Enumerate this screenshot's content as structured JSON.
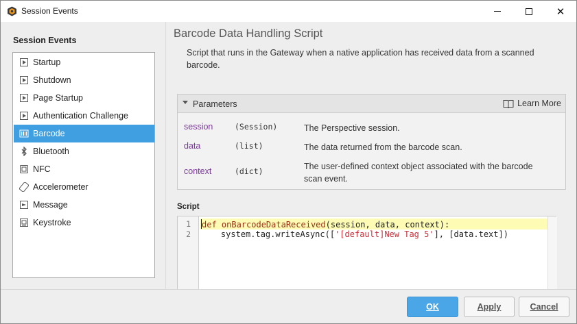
{
  "window": {
    "title": "Session Events",
    "controls": {
      "minimize": "minimize-icon",
      "maximize": "maximize-icon",
      "close": "✕"
    }
  },
  "left": {
    "header": "Session Events",
    "items": [
      {
        "label": "Startup",
        "icon": "play-page-icon"
      },
      {
        "label": "Shutdown",
        "icon": "play-page-icon"
      },
      {
        "label": "Page Startup",
        "icon": "play-page-icon"
      },
      {
        "label": "Authentication Challenge",
        "icon": "play-page-icon"
      },
      {
        "label": "Barcode",
        "icon": "barcode-icon",
        "selected": true
      },
      {
        "label": "Bluetooth",
        "icon": "bluetooth-icon"
      },
      {
        "label": "NFC",
        "icon": "nfc-icon"
      },
      {
        "label": "Accelerometer",
        "icon": "accelerometer-icon"
      },
      {
        "label": "Message",
        "icon": "message-icon"
      },
      {
        "label": "Keystroke",
        "icon": "keystroke-icon"
      }
    ]
  },
  "main": {
    "title": "Barcode Data Handling Script",
    "description": "Script that runs in the Gateway when a native application has received data from a scanned barcode.",
    "parameters": {
      "label": "Parameters",
      "learn_more": "Learn More",
      "rows": [
        {
          "name": "session",
          "type": "(Session)",
          "desc": "The Perspective session."
        },
        {
          "name": "data",
          "type": "(list)",
          "desc": "The data returned from the barcode scan."
        },
        {
          "name": "context",
          "type": "(dict)",
          "desc": "The user-defined context object associated with the barcode scan event."
        }
      ]
    },
    "script": {
      "label": "Script",
      "line_numbers": [
        "1",
        "2"
      ],
      "line1": {
        "kw": "def",
        "fn": " onBarcodeDataReceived",
        "rest": "(session, data, context):"
      },
      "line2": {
        "pre": "    system.tag.writeAsync([",
        "str": "'[default]New Tag 5'",
        "post": "], [data.text])"
      }
    }
  },
  "footer": {
    "ok": "OK",
    "apply": "Apply",
    "cancel": "Cancel"
  },
  "colors": {
    "accent": "#3f9fe0",
    "ok_button": "#4aa6e6",
    "param_name": "#7a3b98",
    "keyword": "#9b2f18",
    "string": "#c8303a",
    "line_highlight": "#fdfbb4"
  }
}
